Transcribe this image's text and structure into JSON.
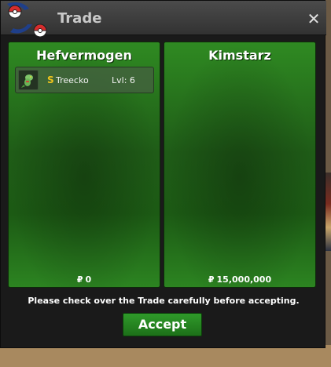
{
  "window": {
    "title": "Trade",
    "close_glyph": "✕"
  },
  "left_panel": {
    "player_name": "Hefvermogen",
    "money_symbol": "₽",
    "money": "0",
    "items": [
      {
        "icon": "treecko-sprite-icon",
        "badge": "S",
        "name": "Treecko",
        "level": "Lvl: 6"
      }
    ]
  },
  "right_panel": {
    "player_name": "Kimstarz",
    "money_symbol": "₽",
    "money": "15,000,000"
  },
  "footer": {
    "notice": "Please check over the Trade carefully before accepting.",
    "accept_label": "Accept"
  },
  "colors": {
    "panel_green": "#2f8a22",
    "button_green": "#2f9a2a",
    "shiny_badge": "#f0c51c"
  }
}
